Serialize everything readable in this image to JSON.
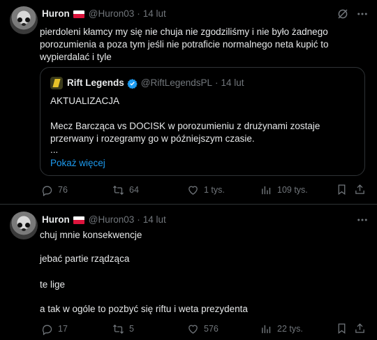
{
  "tweets": [
    {
      "author": {
        "name": "Huron",
        "handle": "@Huron03",
        "time": "14 lut"
      },
      "text": "pierdoleni kłamcy my się nie chuja nie zgodziliśmy i nie było żadnego porozumienia a poza tym jeśli nie potraficie normalnego neta kupić to wypierdalać i tyle",
      "quote": {
        "name": "Rift Legends",
        "handle": "@RiftLegendsPL",
        "time": "14 lut",
        "line1": "AKTUALIZACJA",
        "line2": "Mecz Barcząca vs DOCISK w porozumieniu z drużynami zostaje przerwany i rozegramy go w późniejszym czasie.",
        "ellipsis": "...",
        "show_more": "Pokaż więcej"
      },
      "stats": {
        "replies": "76",
        "reposts": "64",
        "likes": "1 tys.",
        "views": "109 tys."
      }
    },
    {
      "author": {
        "name": "Huron",
        "handle": "@Huron03",
        "time": "14 lut"
      },
      "lines": [
        "chuj mnie konsekwencje",
        "jebać partie rządząca",
        "te lige",
        "a tak w ogóle to pozbyć się riftu i weta prezydenta"
      ],
      "stats": {
        "replies": "17",
        "reposts": "5",
        "likes": "576",
        "views": "22 tys."
      }
    }
  ],
  "sep": "·",
  "colors": {
    "background": "#000000",
    "text": "#e7e9ea",
    "muted": "#71767b",
    "link": "#1d9bf0",
    "border": "#2f3336"
  },
  "icons": [
    "grok-icon",
    "more-icon",
    "verified-icon",
    "reply-icon",
    "repost-icon",
    "like-icon",
    "views-icon",
    "bookmark-icon",
    "share-icon"
  ]
}
